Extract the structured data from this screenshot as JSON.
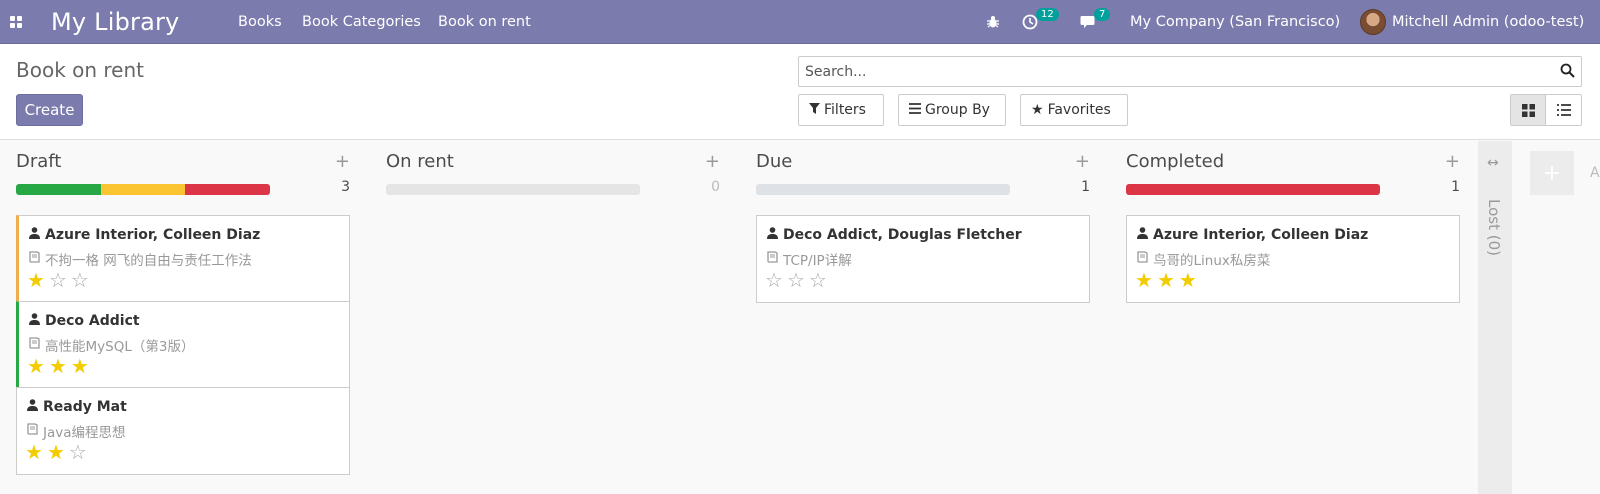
{
  "navbar": {
    "apps_icon": "apps-grid-icon",
    "brand": "My Library",
    "menu": [
      {
        "label": "Books"
      },
      {
        "label": "Book Categories"
      },
      {
        "label": "Book on rent"
      }
    ],
    "activity_count": "12",
    "message_count": "7",
    "company": "My Company (San Francisco)",
    "user": "Mitchell Admin (odoo-test)"
  },
  "control_panel": {
    "title": "Book on rent",
    "create_label": "Create",
    "search_placeholder": "Search...",
    "filters_label": "Filters",
    "group_by_label": "Group By",
    "favorites_label": "Favorites"
  },
  "colors": {
    "brand": "#7c7bad",
    "green": "#28a745",
    "yellow": "#fbc531",
    "red": "#dc3545",
    "star": "#f3cc00"
  },
  "columns": [
    {
      "title": "Draft",
      "count": "3",
      "progress": [
        {
          "color": "#28a745",
          "fraction": 0.3333
        },
        {
          "color": "#fbc531",
          "fraction": 0.3333
        },
        {
          "color": "#dc3545",
          "fraction": 0.3334
        }
      ],
      "cards": [
        {
          "name": "Azure Interior, Colleen Diaz",
          "book": "不拘一格 网飞的自由与责任工作法",
          "stars": 1,
          "accent": "orange"
        },
        {
          "name": "Deco Addict",
          "book": "高性能MySQL（第3版）",
          "stars": 3,
          "accent": "green"
        },
        {
          "name": "Ready Mat",
          "book": "Java编程思想",
          "stars": 2,
          "accent": "none"
        }
      ]
    },
    {
      "title": "On rent",
      "count": "0",
      "progress": [],
      "cards": []
    },
    {
      "title": "Due",
      "count": "1",
      "progress": [
        {
          "color": "#dee2e6",
          "fraction": 1
        }
      ],
      "cards": [
        {
          "name": "Deco Addict, Douglas Fletcher",
          "book": "TCP/IP详解",
          "stars": 0,
          "accent": "none"
        }
      ]
    },
    {
      "title": "Completed",
      "count": "1",
      "progress": [
        {
          "color": "#dc3545",
          "fraction": 1
        }
      ],
      "cards": [
        {
          "name": "Azure Interior, Colleen Diaz",
          "book": "鸟哥的Linux私房菜",
          "stars": 3,
          "accent": "none"
        }
      ]
    }
  ],
  "folded_column": {
    "label": "Lost (0)"
  },
  "add_column_label": "A"
}
